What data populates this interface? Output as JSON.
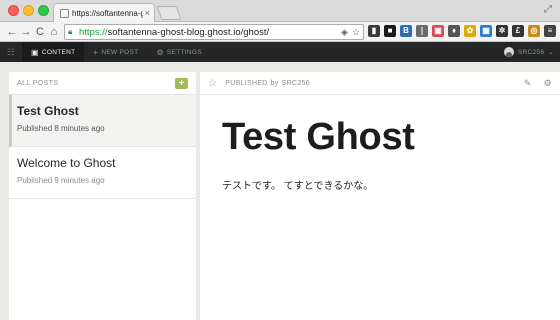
{
  "browser": {
    "tab_title": "https://softantenna-ghos",
    "tab_close": "×",
    "url_https": "https://",
    "url_rest": "softantenna-ghost-blog.ghost.io/ghost/",
    "nav_back": "←",
    "nav_forward": "→",
    "nav_reload": "C",
    "nav_home": "⌂",
    "expand_icon": "⤢",
    "extensions": [
      {
        "name": "ext-1",
        "color": "#3b3b3b",
        "glyph": "▮"
      },
      {
        "name": "ext-2",
        "color": "#1a1a1a",
        "glyph": "■"
      },
      {
        "name": "ext-3",
        "color": "#2b6cb0",
        "glyph": "B"
      },
      {
        "name": "ext-4",
        "color": "#6a6a6a",
        "glyph": "❘"
      },
      {
        "name": "ext-5",
        "color": "#d94b50",
        "glyph": "▣"
      },
      {
        "name": "ext-6",
        "color": "#555",
        "glyph": "♦"
      },
      {
        "name": "ext-7",
        "color": "#e0a800",
        "glyph": "✿"
      },
      {
        "name": "ext-8",
        "color": "#2e7bd6",
        "glyph": "▦"
      },
      {
        "name": "ext-9",
        "color": "#333",
        "glyph": "✲"
      },
      {
        "name": "ext-10",
        "color": "#333",
        "glyph": "£"
      },
      {
        "name": "ext-11",
        "color": "#c98b1e",
        "glyph": "◎"
      },
      {
        "name": "ext-12",
        "color": "#444",
        "glyph": "≡"
      }
    ]
  },
  "ghost_nav": {
    "items": [
      {
        "icon": "▣",
        "label": "CONTENT"
      },
      {
        "icon": "+",
        "label": "NEW POST"
      },
      {
        "icon": "⚙",
        "label": "SETTINGS"
      }
    ],
    "user": "SRC256",
    "user_caret": "⌄"
  },
  "list": {
    "header": "ALL POSTS",
    "add_label": "+",
    "posts": [
      {
        "title": "Test Ghost",
        "meta": "Published 8 minutes ago"
      },
      {
        "title": "Welcome to Ghost",
        "meta": "Published 9 minutes ago"
      }
    ]
  },
  "preview": {
    "status": "PUBLISHED",
    "by": "by",
    "author": "SRC256",
    "star": "☆",
    "edit_icon": "✎",
    "settings_icon": "⚙",
    "title": "Test Ghost",
    "body": "テストです。 てすとできるかな。"
  }
}
